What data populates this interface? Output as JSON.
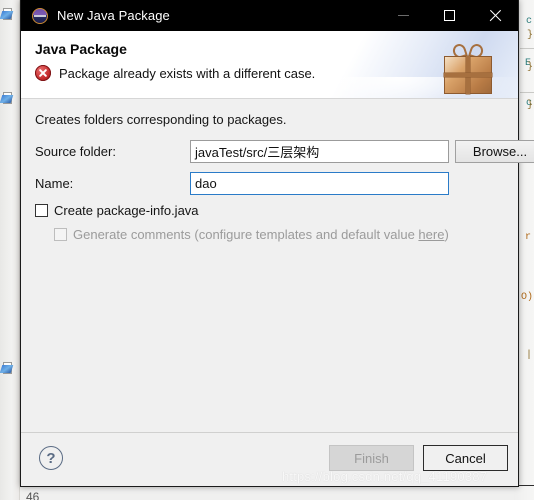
{
  "window": {
    "title": "New Java Package",
    "app_icon": "eclipse-icon",
    "controls": {
      "minimize": "minimize-icon",
      "maximize": "maximize-icon",
      "close": "close-icon"
    }
  },
  "header": {
    "title": "Java Package",
    "message": "Package already exists with a different case.",
    "message_icon": "error-icon",
    "banner_icon": "gift-box-icon",
    "error_color": "#c3292b"
  },
  "form": {
    "description": "Creates folders corresponding to packages.",
    "source_folder": {
      "label": "Source folder:",
      "value": "javaTest/src/三层架构",
      "placeholder": ""
    },
    "name": {
      "label": "Name:",
      "value": "dao",
      "placeholder": ""
    },
    "browse_label": "Browse...",
    "checkboxes": [
      {
        "label": "Create package-info.java",
        "checked": false,
        "enabled": true
      },
      {
        "label_prefix": "Generate comments (configure templates and default value ",
        "link": "here",
        "label_suffix": ")",
        "checked": false,
        "enabled": false
      }
    ],
    "focus_color": "#2a7bc8"
  },
  "footer": {
    "help_label": "?",
    "finish_label": "Finish",
    "finish_enabled": false,
    "cancel_label": "Cancel",
    "cancel_enabled": true
  },
  "backdrop": {
    "line_number": "46",
    "code_fragments": [
      {
        "text": "c",
        "color": "#2b7b7b"
      },
      {
        "text": "}",
        "color": "#8a6a28"
      },
      {
        "text": "E",
        "color": "#2b7b7b"
      },
      {
        "text": "}",
        "color": "#8a6a28"
      },
      {
        "text": "c",
        "color": "#2b7b7b"
      },
      {
        "text": "}",
        "color": "#8a6a28"
      },
      {
        "text": "r",
        "color": "#b06a1a"
      },
      {
        "text": "O)",
        "color": "#b06a1a"
      },
      {
        "text": "|",
        "color": "#8a6a28"
      }
    ]
  },
  "watermark": {
    "text": "https://blog.csdn.net/qq_41190387"
  }
}
